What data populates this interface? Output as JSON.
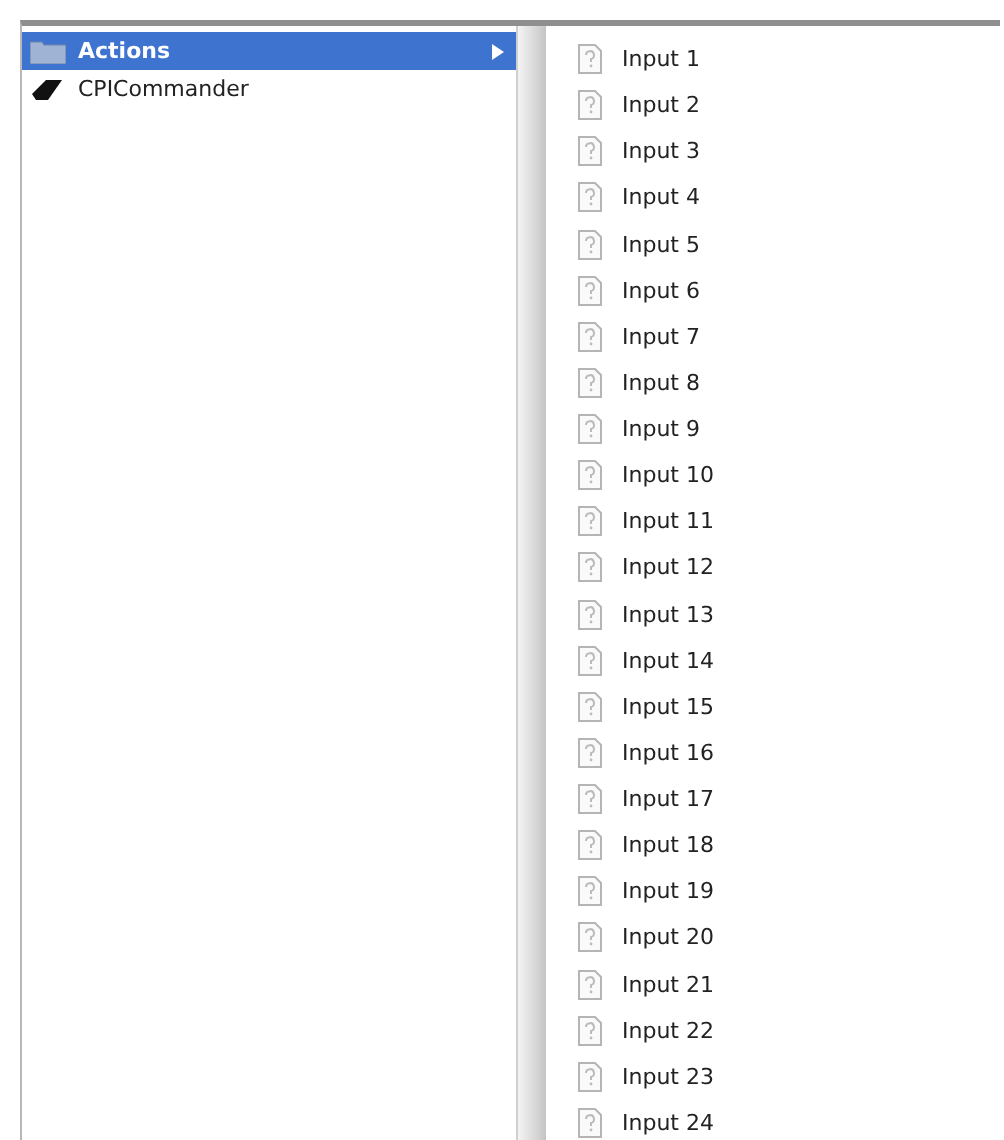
{
  "columns": [
    {
      "items": [
        {
          "label": "Actions",
          "kind": "folder",
          "selected": true,
          "has_children": true
        },
        {
          "label": "CPICommander",
          "kind": "app",
          "selected": false,
          "has_children": false
        }
      ]
    },
    {
      "items": [
        {
          "label": "Input 1",
          "kind": "file",
          "selected": false,
          "has_children": false
        },
        {
          "label": "Input 2",
          "kind": "file",
          "selected": false,
          "has_children": false
        },
        {
          "label": "Input 3",
          "kind": "file",
          "selected": false,
          "has_children": false
        },
        {
          "label": "Input 4",
          "kind": "file",
          "selected": false,
          "has_children": false
        },
        {
          "label": "Input 5",
          "kind": "file",
          "selected": false,
          "has_children": false
        },
        {
          "label": "Input 6",
          "kind": "file",
          "selected": false,
          "has_children": false
        },
        {
          "label": "Input 7",
          "kind": "file",
          "selected": false,
          "has_children": false
        },
        {
          "label": "Input 8",
          "kind": "file",
          "selected": false,
          "has_children": false
        },
        {
          "label": "Input 9",
          "kind": "file",
          "selected": false,
          "has_children": false
        },
        {
          "label": "Input 10",
          "kind": "file",
          "selected": false,
          "has_children": false
        },
        {
          "label": "Input 11",
          "kind": "file",
          "selected": false,
          "has_children": false
        },
        {
          "label": "Input 12",
          "kind": "file",
          "selected": false,
          "has_children": false
        },
        {
          "label": "Input 13",
          "kind": "file",
          "selected": false,
          "has_children": false
        },
        {
          "label": "Input 14",
          "kind": "file",
          "selected": false,
          "has_children": false
        },
        {
          "label": "Input 15",
          "kind": "file",
          "selected": false,
          "has_children": false
        },
        {
          "label": "Input 16",
          "kind": "file",
          "selected": false,
          "has_children": false
        },
        {
          "label": "Input 17",
          "kind": "file",
          "selected": false,
          "has_children": false
        },
        {
          "label": "Input 18",
          "kind": "file",
          "selected": false,
          "has_children": false
        },
        {
          "label": "Input 19",
          "kind": "file",
          "selected": false,
          "has_children": false
        },
        {
          "label": "Input 20",
          "kind": "file",
          "selected": false,
          "has_children": false
        },
        {
          "label": "Input 21",
          "kind": "file",
          "selected": false,
          "has_children": false
        },
        {
          "label": "Input 22",
          "kind": "file",
          "selected": false,
          "has_children": false
        },
        {
          "label": "Input 23",
          "kind": "file",
          "selected": false,
          "has_children": false
        },
        {
          "label": "Input 24",
          "kind": "file",
          "selected": false,
          "has_children": false
        }
      ]
    }
  ]
}
